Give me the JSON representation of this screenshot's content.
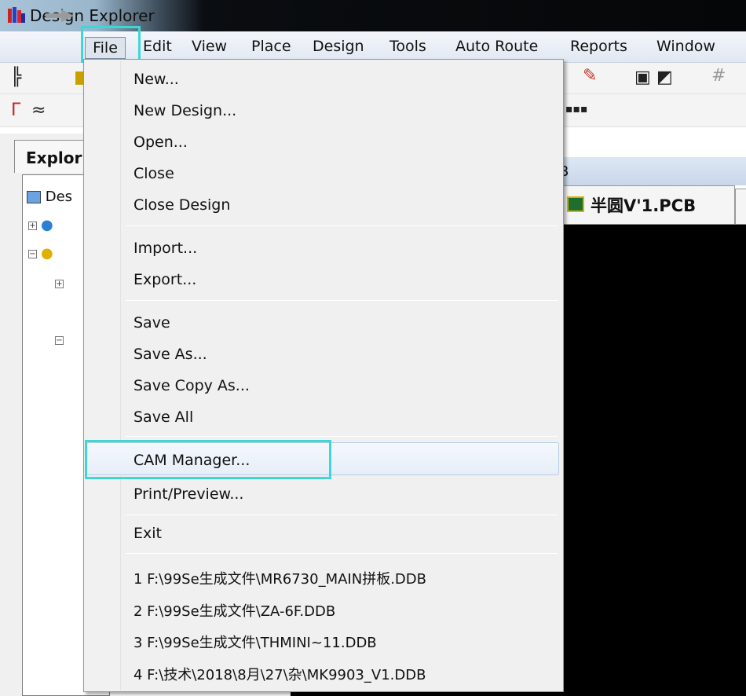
{
  "window": {
    "title": "Design Explorer"
  },
  "menubar": {
    "items": [
      "File",
      "Edit",
      "View",
      "Place",
      "Design",
      "Tools",
      "Auto Route",
      "Reports",
      "Window"
    ]
  },
  "explorer": {
    "tab_label": "Explor",
    "root_label": "Des"
  },
  "editor": {
    "strip_text": "B",
    "doc_tab_label": "半圆V'1.PCB"
  },
  "file_menu": {
    "group1": [
      "New...",
      "New Design...",
      "Open...",
      "Close",
      "Close Design"
    ],
    "group2": [
      "Import...",
      "Export..."
    ],
    "group3": [
      "Save",
      "Save As...",
      "Save Copy As...",
      "Save All"
    ],
    "group4": [
      "CAM Manager...",
      "Print/Preview..."
    ],
    "group5": [
      "Exit"
    ],
    "recent_files": [
      "1 F:\\99Se生成文件\\MR6730_MAIN拼板.DDB",
      "2 F:\\99Se生成文件\\ZA-6F.DDB",
      "3 F:\\99Se生成文件\\THMINI~11.DDB",
      "4 F:\\技术\\2018\\8月\\27\\杂\\MK9903_V1.DDB"
    ]
  },
  "colors": {
    "highlight": "#3fd6d6",
    "menu_bg": "#f0f0f0",
    "canvas": "#000000"
  },
  "annotations": {
    "highlighted_menu": "File",
    "highlighted_item": "CAM Manager..."
  }
}
